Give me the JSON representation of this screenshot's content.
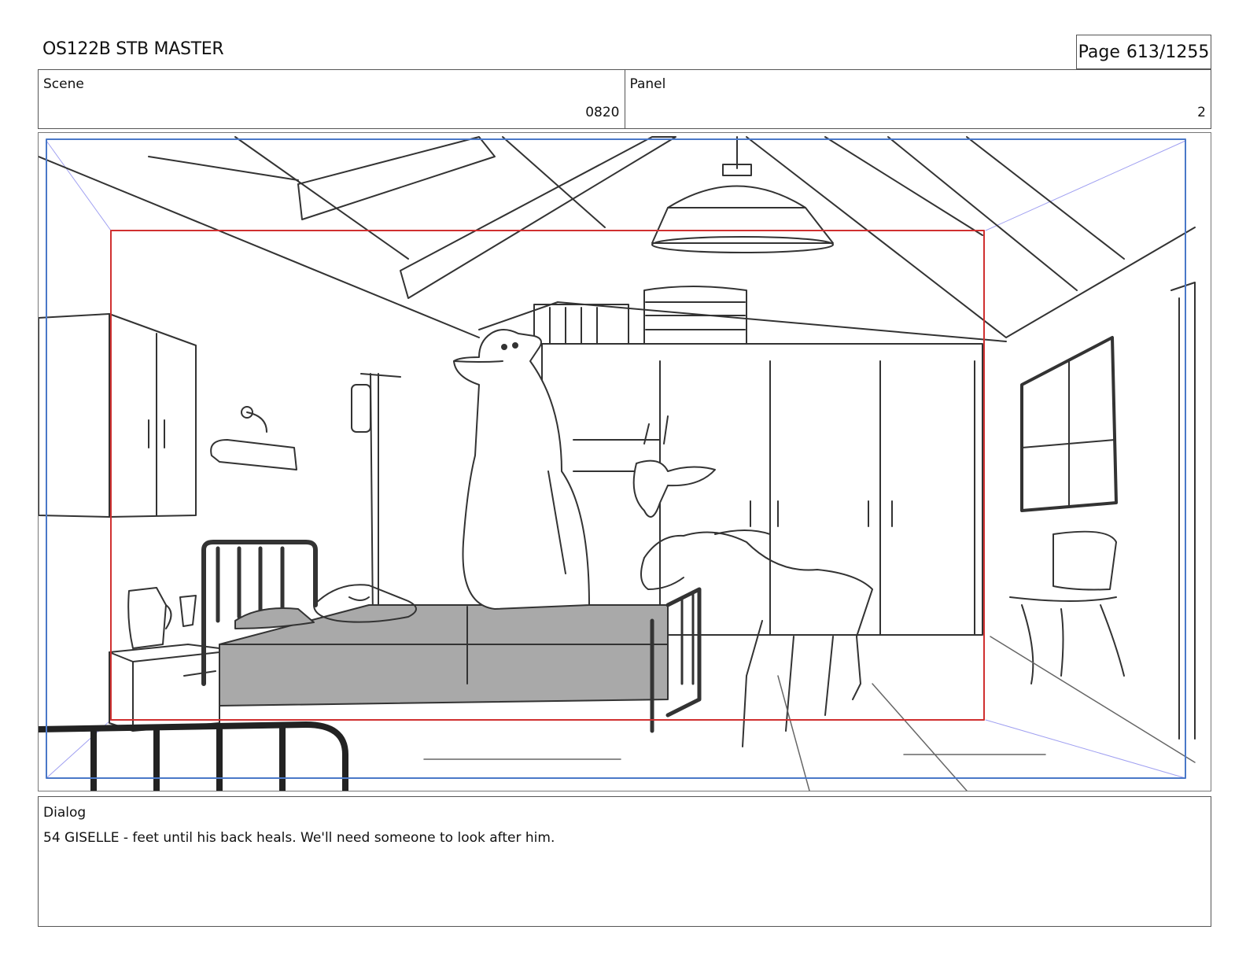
{
  "header": {
    "title": "OS122B STB MASTER",
    "page_label": "Page",
    "page_number": "613/1255"
  },
  "info": {
    "scene_label": "Scene",
    "scene_value": "0820",
    "panel_label": "Panel",
    "panel_value": "2"
  },
  "dialog": {
    "label": "Dialog",
    "text": "54 GISELLE - feet until his back heals. We'll need someone to look after him."
  },
  "colors": {
    "camera_frame": "#4a78c8",
    "safe_frame": "#d03030",
    "sketch_line": "#333333",
    "bed_fill": "#a9a9a9"
  }
}
